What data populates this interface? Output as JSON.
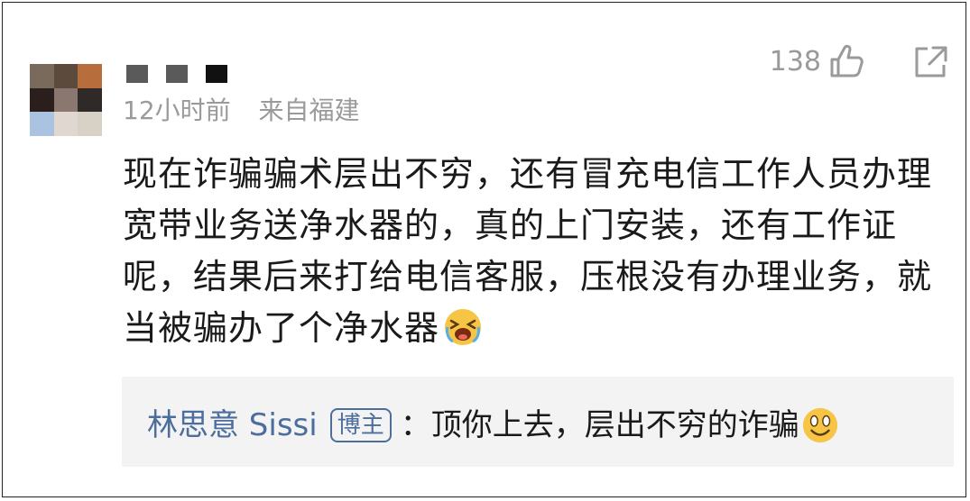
{
  "comment": {
    "time": "12小时前",
    "location": "来自福建",
    "likes": "138",
    "text": "现在诈骗骗术层出不穷，还有冒充电信工作人员办理宽带业务送净水器的，真的上门安装，还有工作证呢，结果后来打给电信客服，压根没有办理业务，就当被骗办了个净水器",
    "avatar_colors": [
      "#7a6a5c",
      "#5c4a3d",
      "#b86d3c",
      "#2a1f1c",
      "#8a7770",
      "#2f2a27",
      "#a9c3e0",
      "#e0d8d0",
      "#d8d2c6"
    ],
    "icons": {
      "like": "thumbs-up-icon",
      "share": "share-icon",
      "emoji_cry": "crying-emoji-icon",
      "emoji_smile": "smiling-emoji-icon"
    }
  },
  "reply": {
    "author": "林思意 Sissi",
    "badge": "博主",
    "text": "：顶你上去，层出不穷的诈骗"
  }
}
